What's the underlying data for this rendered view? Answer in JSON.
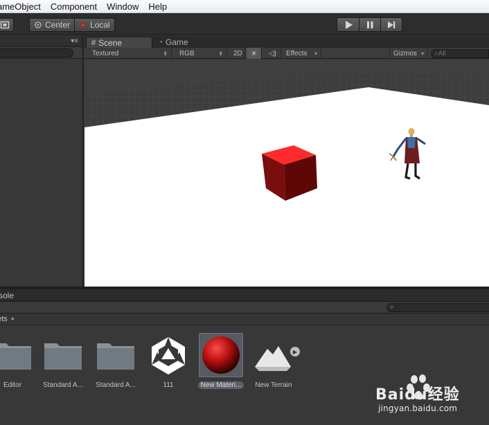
{
  "menubar": {
    "items": [
      "ameObject",
      "Component",
      "Window",
      "Help"
    ]
  },
  "toolbar": {
    "pivot_label": "Center",
    "space_label": "Local",
    "play_icon": "play-icon",
    "pause_icon": "pause-icon",
    "step_icon": "step-icon"
  },
  "scene": {
    "tab_scene": "Scene",
    "tab_game": "Game",
    "render_mode": "Textured",
    "color_mode": "RGB",
    "mode_2d": "2D",
    "effects_label": "Effects",
    "gizmos_label": "Gizmos",
    "search_placeholder": "All"
  },
  "console": {
    "tab_label": "sole"
  },
  "project": {
    "breadcrumb": "ets",
    "breadcrumb_arrow": "▸",
    "assets": [
      {
        "label": "Editor",
        "icon": "folder-icon"
      },
      {
        "label": "Standard A...",
        "icon": "folder-icon"
      },
      {
        "label": "Standard A...",
        "icon": "folder-icon"
      },
      {
        "label": "111",
        "icon": "unity-logo-icon"
      },
      {
        "label": "New Materi...",
        "icon": "material-sphere-icon"
      },
      {
        "label": "New Terrain",
        "icon": "terrain-icon"
      }
    ]
  },
  "watermark": {
    "brand": "Baidu经验",
    "url": "jingyan.baidu.com"
  }
}
